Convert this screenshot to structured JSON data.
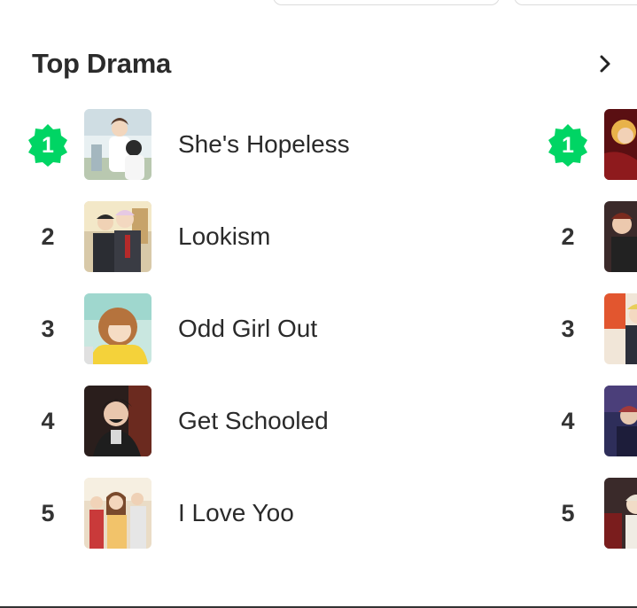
{
  "section": {
    "title": "Top Drama",
    "more_icon": "chevron-right-icon"
  },
  "accent_color": "#00d564",
  "ranking": [
    {
      "rank": "1",
      "title": "She's Hopeless",
      "thumb": "she-s-hopeless-cover"
    },
    {
      "rank": "2",
      "title": "Lookism",
      "thumb": "lookism-cover"
    },
    {
      "rank": "3",
      "title": "Odd Girl Out",
      "thumb": "odd-girl-out-cover"
    },
    {
      "rank": "4",
      "title": "Get Schooled",
      "thumb": "get-schooled-cover"
    },
    {
      "rank": "5",
      "title": "I Love Yoo",
      "thumb": "i-love-yoo-cover"
    }
  ],
  "next_column": [
    {
      "rank": "1"
    },
    {
      "rank": "2"
    },
    {
      "rank": "3"
    },
    {
      "rank": "4"
    },
    {
      "rank": "5"
    }
  ]
}
